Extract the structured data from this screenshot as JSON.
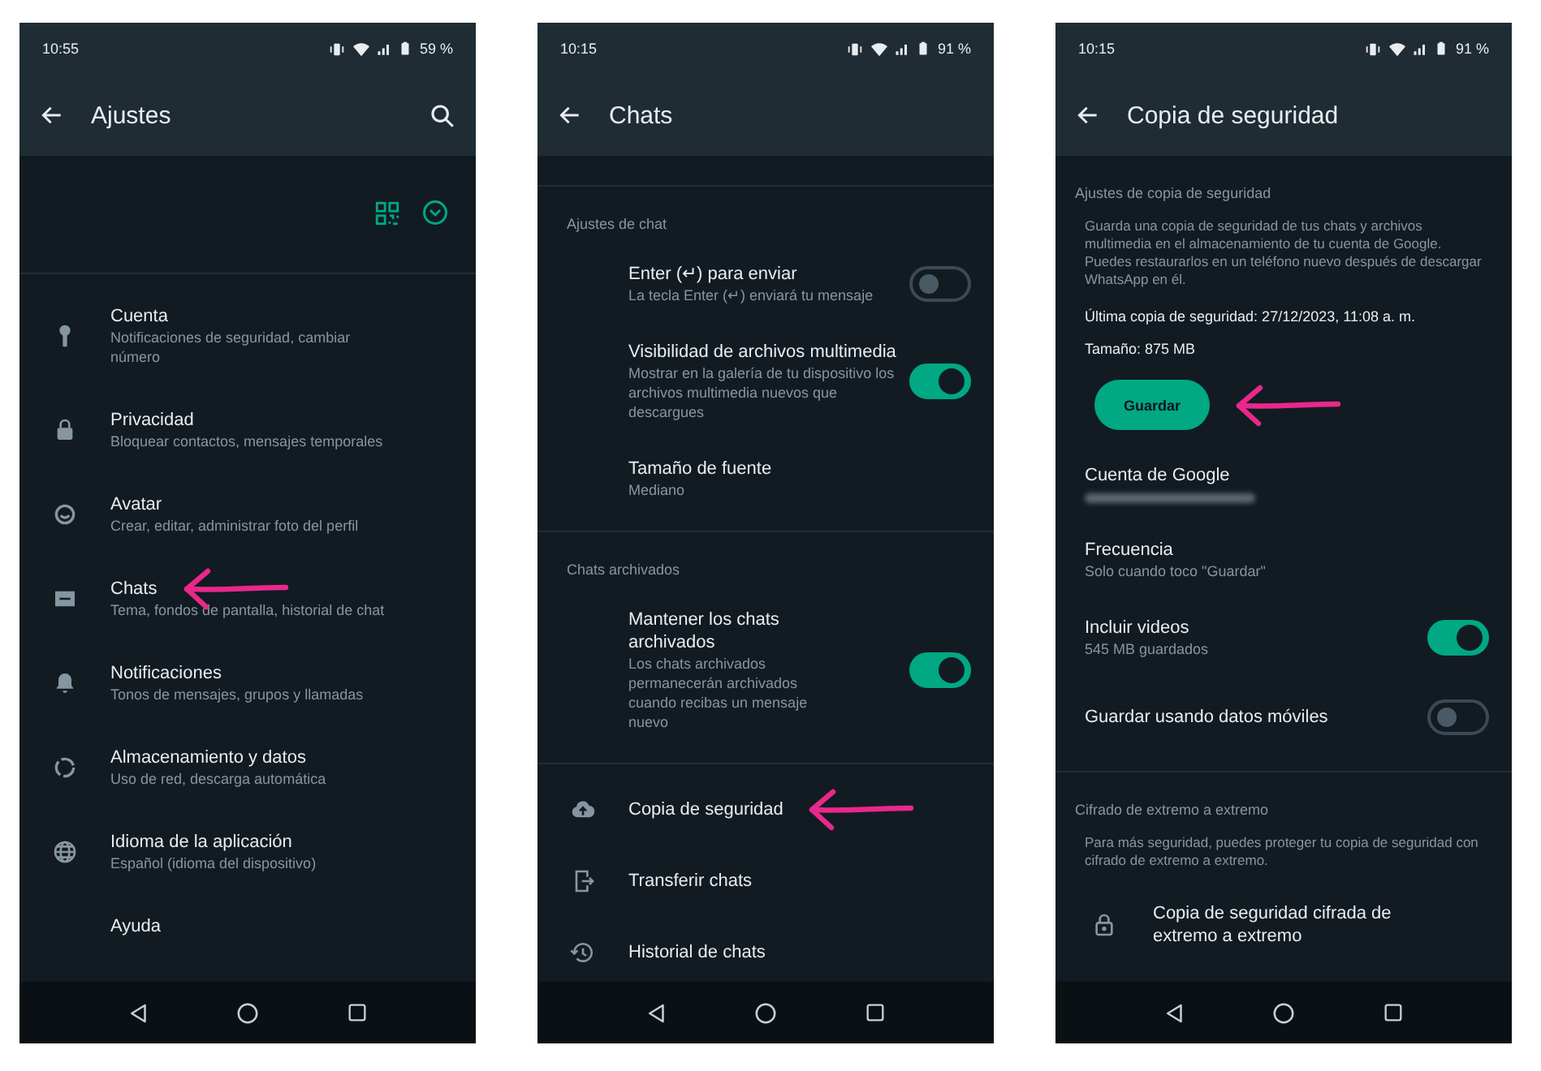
{
  "screens": [
    {
      "kind": "settings",
      "status": {
        "time": "10:55",
        "battery": "59 %"
      },
      "title": "Ajustes",
      "sections": [
        {
          "kind": "profile"
        },
        {
          "kind": "list",
          "items": [
            {
              "kind": "link",
              "title": "Cuenta",
              "subtitle": "Notificaciones de seguridad, cambiar número",
              "pointed": false
            },
            {
              "kind": "link",
              "title": "Privacidad",
              "subtitle": "Bloquear contactos, mensajes temporales",
              "pointed": false
            },
            {
              "kind": "link",
              "title": "Avatar",
              "subtitle": "Crear, editar, administrar foto del perfil",
              "pointed": false
            },
            {
              "kind": "link",
              "title": "Chats",
              "subtitle": "Tema, fondos de pantalla, historial de chat",
              "pointed": true
            },
            {
              "kind": "link",
              "title": "Notificaciones",
              "subtitle": "Tonos de mensajes, grupos y llamadas",
              "pointed": false
            },
            {
              "kind": "link",
              "title": "Almacenamiento y datos",
              "subtitle": "Uso de red, descarga automática",
              "pointed": false
            },
            {
              "kind": "link",
              "title": "Idioma de la aplicación",
              "subtitle": "Español (idioma del dispositivo)",
              "pointed": false
            },
            {
              "kind": "link",
              "title": "Ayuda",
              "pointed": false
            }
          ]
        }
      ]
    },
    {
      "kind": "chats",
      "status": {
        "time": "10:15",
        "battery": "91 %"
      },
      "title": "Chats",
      "sections": [
        {
          "kind": "list",
          "header": "Ajustes de chat",
          "items": [
            {
              "kind": "toggle",
              "title": "Enter (↵) para enviar",
              "subtitle": "La tecla Enter (↵) enviará tu mensaje",
              "on": false
            },
            {
              "kind": "toggle",
              "title": "Visibilidad de archivos multimedia",
              "subtitle": "Mostrar en la galería de tu dispositivo los archivos multimedia nuevos que descargues",
              "on": true
            },
            {
              "kind": "link",
              "title": "Tamaño de fuente",
              "subtitle": "Mediano",
              "pointed": false
            }
          ]
        },
        {
          "kind": "list",
          "header": "Chats archivados",
          "items": [
            {
              "kind": "toggle",
              "title": "Mantener los chats archivados",
              "subtitle": "Los chats archivados permanecerán archivados cuando recibas un mensaje nuevo",
              "on": true
            }
          ]
        },
        {
          "kind": "list",
          "items": [
            {
              "kind": "link",
              "title": "Copia de seguridad",
              "pointed": true
            },
            {
              "kind": "link",
              "title": "Transferir chats",
              "pointed": false
            },
            {
              "kind": "link",
              "title": "Historial de chats",
              "pointed": false
            }
          ]
        }
      ]
    },
    {
      "kind": "backup",
      "status": {
        "time": "10:15",
        "battery": "91 %"
      },
      "title": "Copia de seguridad",
      "sections": [
        {
          "kind": "list",
          "header": "Ajustes de copia de seguridad",
          "items": [
            {
              "kind": "text",
              "text": "Guarda una copia de seguridad de tus chats y archivos multimedia en el almacenamiento de tu cuenta de Google. Puedes restaurarlos en un teléfono nuevo después de descargar WhatsApp en él."
            },
            {
              "kind": "info",
              "text": "Última copia de seguridad: 27/12/2023, 11:08 a. m."
            },
            {
              "kind": "info",
              "text": "Tamaño: 875 MB"
            },
            {
              "kind": "button",
              "label": "Guardar",
              "pointed": true
            },
            {
              "kind": "link",
              "title": "Cuenta de Google",
              "subtitle_redacted": true,
              "pointed": false
            },
            {
              "kind": "link",
              "title": "Frecuencia",
              "subtitle": "Solo cuando toco \"Guardar\"",
              "pointed": false
            },
            {
              "kind": "toggle",
              "title": "Incluir videos",
              "subtitle": "545 MB guardados",
              "on": true
            },
            {
              "kind": "toggle",
              "title": "Guardar usando datos móviles",
              "on": false
            }
          ]
        },
        {
          "kind": "list",
          "header": "Cifrado de extremo a extremo",
          "items": [
            {
              "kind": "text",
              "text": "Para más seguridad, puedes proteger tu copia de seguridad con cifrado de extremo a extremo."
            },
            {
              "kind": "link",
              "title": "Copia de seguridad cifrada de extremo a extremo",
              "pointed": false
            }
          ]
        }
      ]
    }
  ]
}
